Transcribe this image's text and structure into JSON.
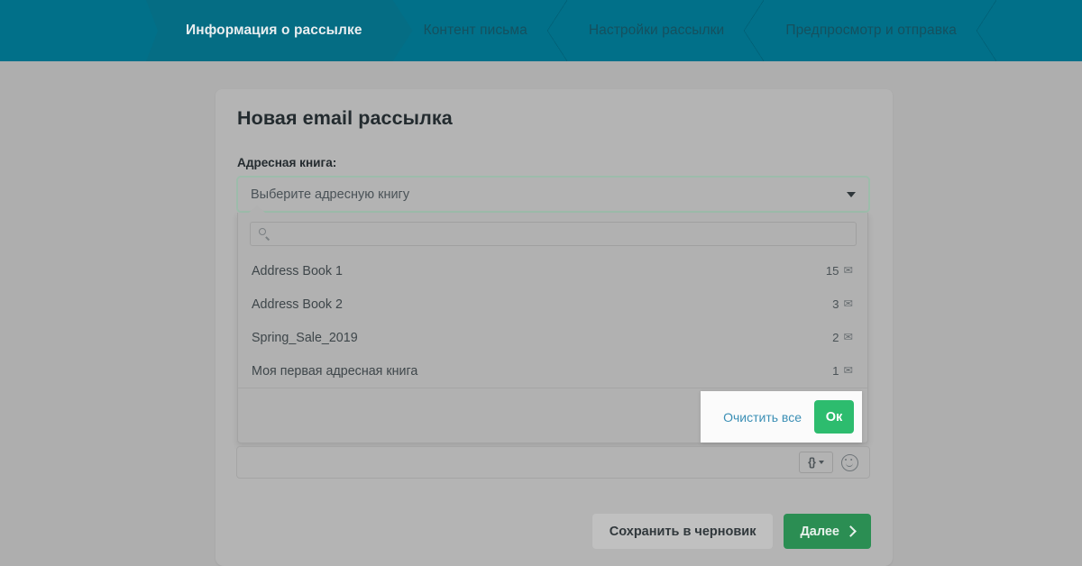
{
  "wizard": {
    "tabs": [
      {
        "label": "Информация о рассылке",
        "active": true
      },
      {
        "label": "Контент письма",
        "active": false
      },
      {
        "label": "Настройки рассылки",
        "active": false
      },
      {
        "label": "Предпросмотр и отправка",
        "active": false
      }
    ]
  },
  "card": {
    "title": "Новая email рассылка",
    "address_book": {
      "label": "Адресная книга:",
      "placeholder": "Выберите адресную книгу",
      "caret_icon": "chevron-down-icon"
    },
    "dropdown": {
      "search_placeholder": "",
      "search_value": "",
      "search_icon": "search-icon",
      "options": [
        {
          "name": "Address Book 1",
          "count": "15",
          "icon": "envelope-icon"
        },
        {
          "name": "Address Book 2",
          "count": "3",
          "icon": "envelope-icon"
        },
        {
          "name": "Spring_Sale_2019",
          "count": "2",
          "icon": "envelope-icon"
        },
        {
          "name": "Моя первая адресная книга",
          "count": "1",
          "icon": "envelope-icon"
        }
      ],
      "footer": {
        "clear_all_label": "Очистить все",
        "ok_label": "Ок"
      }
    },
    "subject_field": {
      "value": "",
      "placeholder": "",
      "merge_tag_icon": "curly-braces-icon",
      "merge_tag_caret_icon": "chevron-down-icon",
      "emoji_icon": "smiley-icon"
    },
    "actions": {
      "draft_label": "Сохранить в черновик",
      "next_label": "Далее",
      "next_icon": "chevron-right-icon"
    }
  },
  "colors": {
    "header_teal": "#017089",
    "active_tab_teal": "#056d84",
    "accent_green": "#2dbc6e",
    "next_green": "#2b8e53",
    "link_blue": "#3b8fb5",
    "select_border_green": "#9dbcab",
    "page_grey": "#aeaeae"
  }
}
